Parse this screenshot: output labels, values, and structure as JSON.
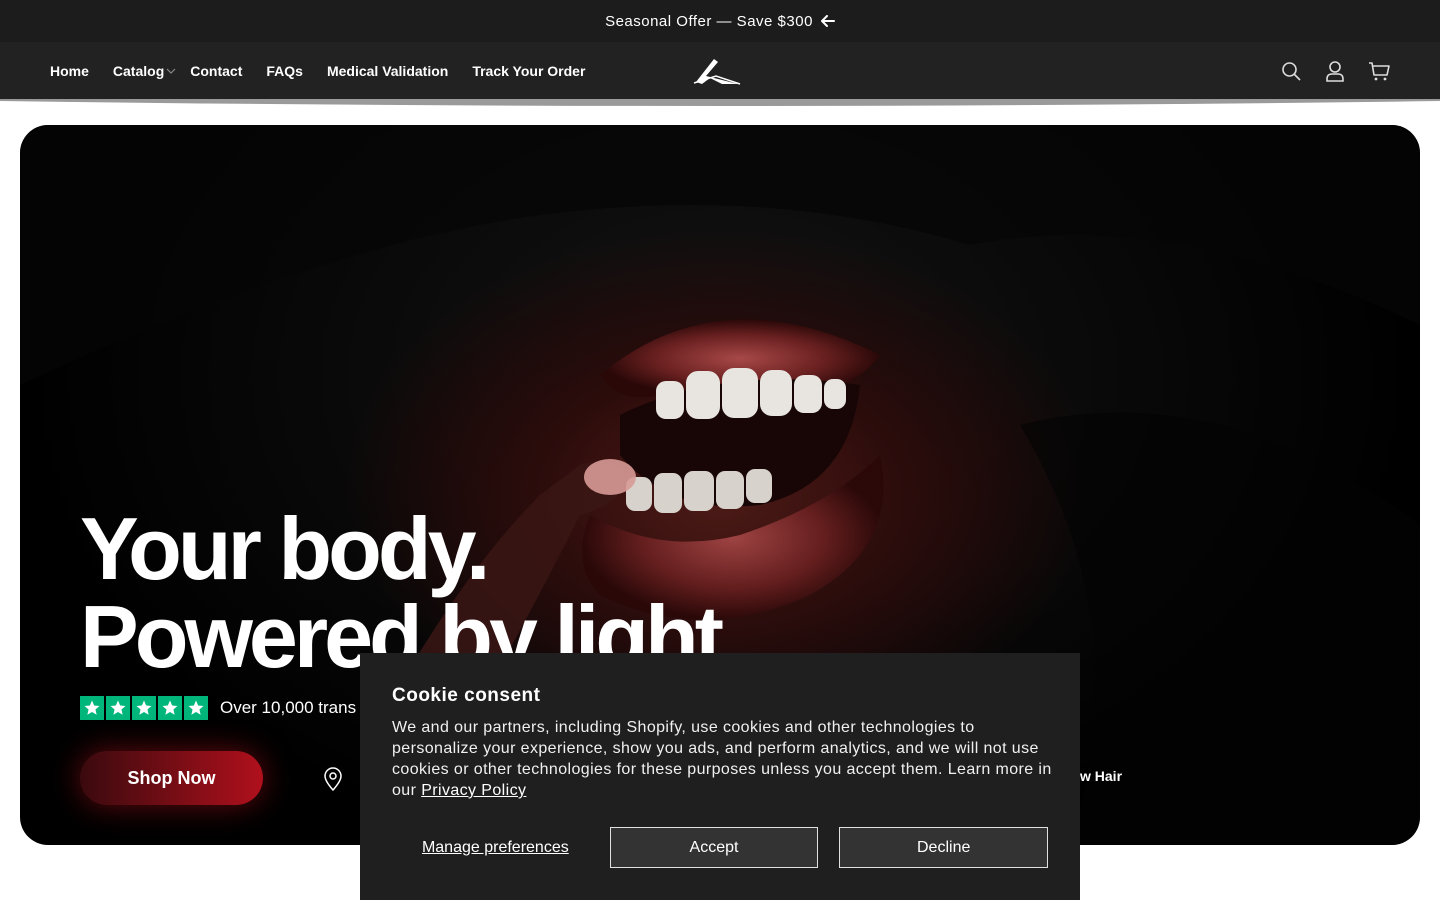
{
  "announcement": {
    "text": "Seasonal Offer — Save $300",
    "icon": "arrow-left-icon"
  },
  "nav": {
    "items": [
      {
        "label": "Home"
      },
      {
        "label": "Catalog",
        "has_dropdown": true
      },
      {
        "label": "Contact"
      },
      {
        "label": "FAQs"
      },
      {
        "label": "Medical Validation"
      },
      {
        "label": "Track Your Order"
      }
    ]
  },
  "header_icons": [
    "search-icon",
    "account-icon",
    "cart-icon"
  ],
  "hero": {
    "headline_line1": "Your body.",
    "headline_line2": "Powered by light",
    "rating_text": "Over 10,000 trans",
    "stars": 5,
    "cta_label": "Shop Now",
    "feature_right": "w Hair",
    "colors": {
      "cta": "#b0101c",
      "stars": "#00b67a"
    }
  },
  "cookie": {
    "title": "Cookie consent",
    "body": "We and our partners, including Shopify, use cookies and other technologies to personalize your experience, show you ads, and perform analytics, and we will not use cookies or other technologies for these purposes unless you accept them. Learn more in our",
    "link_label": "Privacy Policy",
    "manage_label": "Manage preferences",
    "accept_label": "Accept",
    "decline_label": "Decline"
  }
}
